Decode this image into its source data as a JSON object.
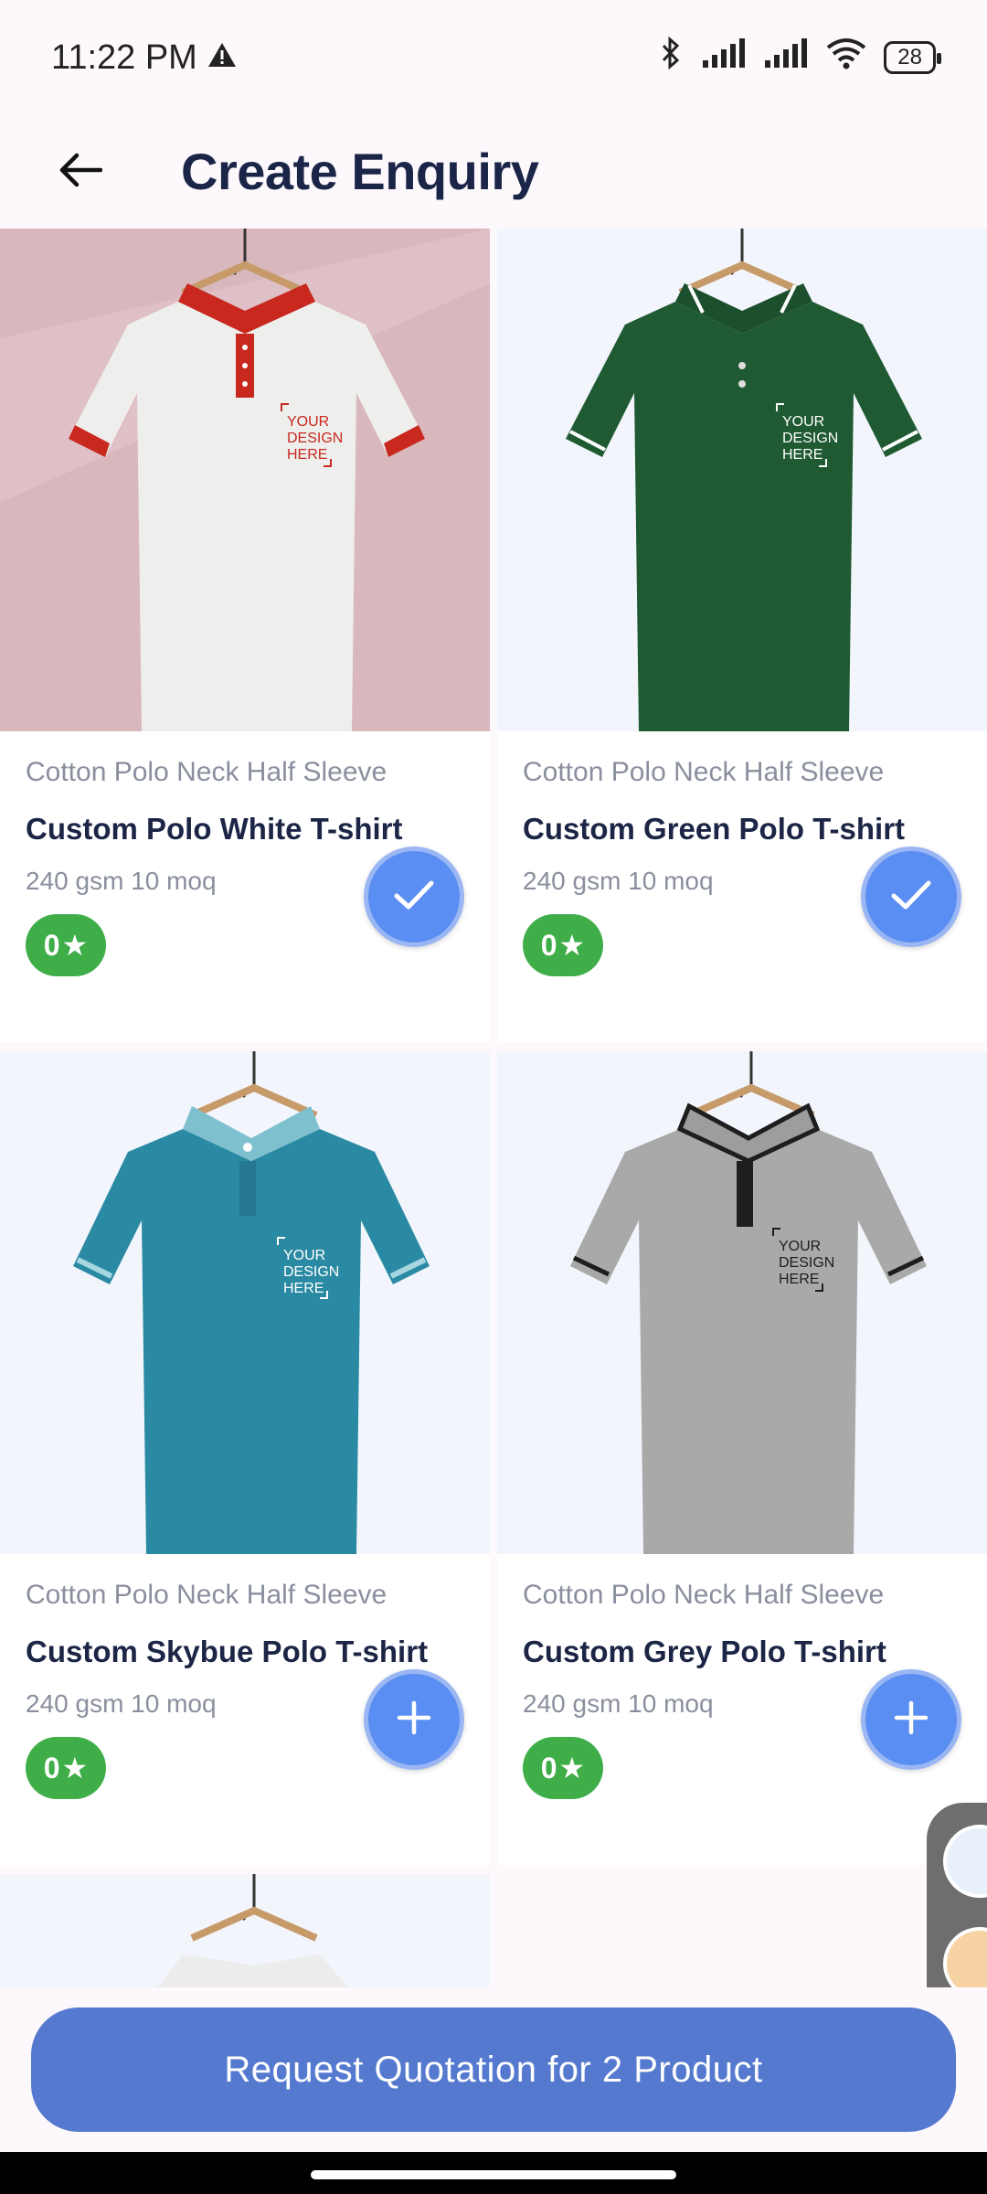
{
  "status_bar": {
    "time": "11:22 PM",
    "battery": "28",
    "icons": [
      "alert-icon",
      "bluetooth-icon",
      "signal-icon",
      "signal-icon",
      "wifi-icon",
      "battery-icon"
    ]
  },
  "header": {
    "title": "Create Enquiry",
    "back_icon": "arrow-left-icon"
  },
  "products": [
    {
      "category": "Cotton Polo Neck Half Sleeve",
      "title": "Custom Polo White T-shirt",
      "spec": "240 gsm 10 moq",
      "rating": "0",
      "selected": true,
      "colors": {
        "shirt": "#eeeeec",
        "collar": "#c8281e",
        "bg": "#d7b5bc"
      }
    },
    {
      "category": "Cotton Polo Neck Half Sleeve",
      "title": "Custom Green Polo T-shirt",
      "spec": "240 gsm 10 moq",
      "rating": "0",
      "selected": true,
      "colors": {
        "shirt": "#1f5a33",
        "collar": "#1f5a33",
        "bg": "#f2f6fc"
      }
    },
    {
      "category": "Cotton Polo Neck Half Sleeve",
      "title": "Custom Skybue Polo T-shirt",
      "spec": "240 gsm 10 moq",
      "rating": "0",
      "selected": false,
      "colors": {
        "shirt": "#2b8aa3",
        "collar": "#7fc0cf",
        "bg": "#f2f6fc"
      }
    },
    {
      "category": "Cotton Polo Neck Half Sleeve",
      "title": "Custom Grey Polo T-shirt",
      "spec": "240 gsm 10 moq",
      "rating": "0",
      "selected": false,
      "colors": {
        "shirt": "#a9a9a9",
        "collar": "#1e1e1e",
        "bg": "#f2f6fc"
      }
    }
  ],
  "design_text": [
    "YOUR",
    "DESIGN",
    "HERE"
  ],
  "cta": {
    "label": "Request Quotation for 2 Product"
  },
  "colors": {
    "accent": "#5479cf",
    "fab": "#5b8ef2",
    "rating_badge": "#3fae49"
  }
}
